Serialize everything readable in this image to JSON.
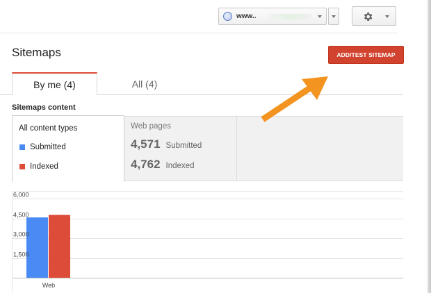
{
  "topbar": {
    "site_label": "www..",
    "site_globe_icon": "globe-icon",
    "settings_icon": "gear-icon"
  },
  "page": {
    "title": "Sitemaps",
    "add_button": "ADD/TEST SITEMAP"
  },
  "tabs": [
    {
      "label": "By me (4)",
      "active": true
    },
    {
      "label": "All (4)",
      "active": false
    }
  ],
  "content": {
    "section_title": "Sitemaps content",
    "filter_title": "All content types",
    "legend": [
      {
        "label": "Submitted",
        "color": "#4a8af4"
      },
      {
        "label": "Indexed",
        "color": "#dd4b39"
      }
    ],
    "web_pages": {
      "title": "Web pages",
      "submitted_value": "4,571",
      "submitted_label": "Submitted",
      "indexed_value": "4,762",
      "indexed_label": "Indexed"
    }
  },
  "colors": {
    "accent_red": "#dd4b39",
    "submitted_blue": "#4a8af4",
    "arrow_orange": "#f39420"
  },
  "chart_data": {
    "type": "bar",
    "categories": [
      "Web"
    ],
    "series": [
      {
        "name": "Submitted",
        "values": [
          4571
        ],
        "color": "#4a8af4"
      },
      {
        "name": "Indexed",
        "values": [
          4762
        ],
        "color": "#dd4b39"
      }
    ],
    "yticks": [
      "6,000",
      "4,500",
      "3,000",
      "1,500"
    ],
    "ytick_values": [
      6000,
      4500,
      3000,
      1500
    ],
    "ylim": [
      0,
      6000
    ],
    "grid": true,
    "title": "",
    "xlabel": "",
    "ylabel": ""
  }
}
